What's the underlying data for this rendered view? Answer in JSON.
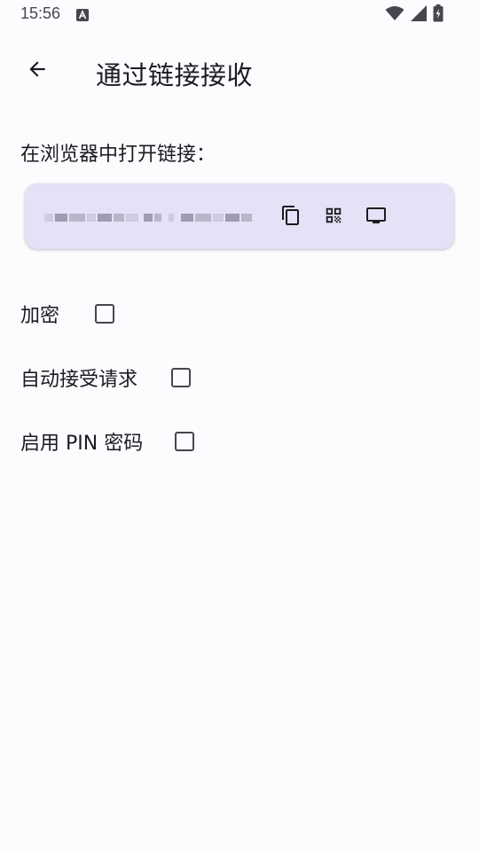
{
  "status_bar": {
    "time": "15:56"
  },
  "app_bar": {
    "title": "通过链接接收"
  },
  "main": {
    "open_in_browser_label": "在浏览器中打开链接：",
    "options": [
      {
        "label": "加密",
        "checked": false
      },
      {
        "label": "自动接受请求",
        "checked": false
      },
      {
        "label": "启用 PIN 密码",
        "checked": false
      }
    ]
  },
  "colors": {
    "background": "#fefbff",
    "card": "#e5e1f6",
    "text": "#1c1b1f",
    "icon": "#46464f"
  }
}
